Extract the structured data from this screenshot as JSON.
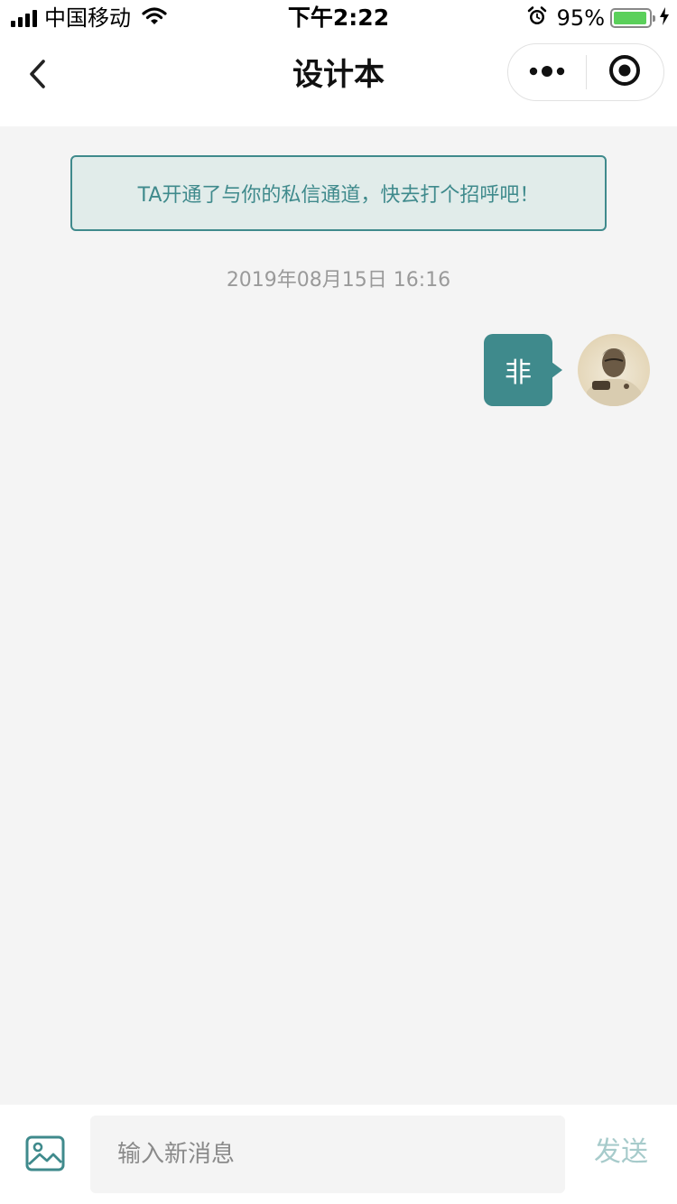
{
  "status_bar": {
    "carrier": "中国移动",
    "time": "下午2:22",
    "battery_percent": "95%",
    "battery_level": 0.95,
    "battery_color": "#5bd05b"
  },
  "nav": {
    "title": "设计本",
    "back_icon": "chevron-left-icon",
    "more_icon": "more-dots-icon",
    "close_icon": "target-circle-icon"
  },
  "chat": {
    "notice": "TA开通了与你的私信通道，快去打个招呼吧！",
    "timestamp": "2019年08月15日 16:16",
    "messages": [
      {
        "from": "me",
        "text": "非"
      }
    ]
  },
  "input_bar": {
    "image_icon": "image-icon",
    "placeholder": "输入新消息",
    "send_label": "发送"
  },
  "colors": {
    "accent": "#3f8a8c",
    "notice_bg": "#e1ecea",
    "send_disabled": "#a7cbcb",
    "page_bg": "#f4f4f4"
  }
}
